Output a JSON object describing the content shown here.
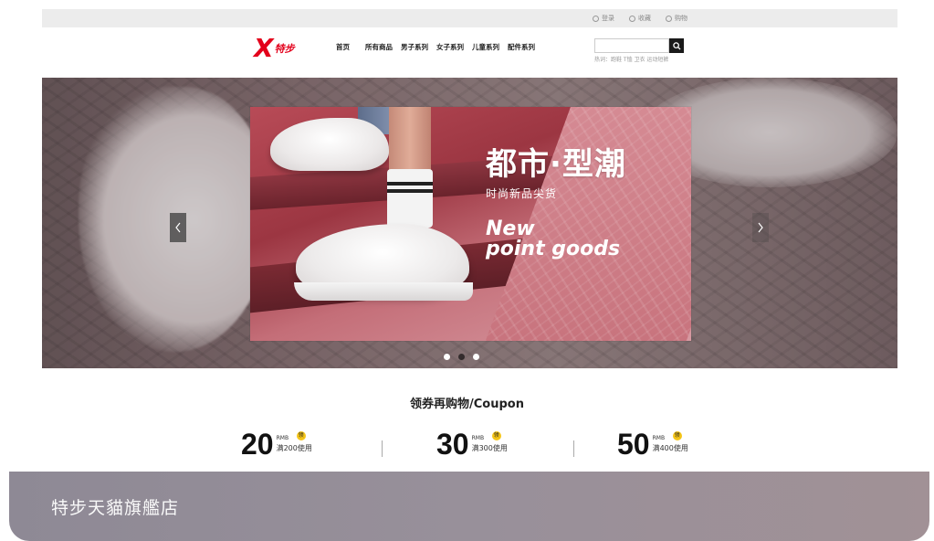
{
  "topbar": {
    "links": [
      {
        "label": "登录",
        "icon": "user-icon"
      },
      {
        "label": "收藏",
        "icon": "star-icon"
      },
      {
        "label": "购物",
        "icon": "cart-icon"
      }
    ]
  },
  "header": {
    "logo_text": "特步",
    "nav": [
      "首页",
      "所有商品",
      "男子系列",
      "女子系列",
      "儿童系列",
      "配件系列"
    ],
    "search": {
      "placeholder": "",
      "hot_words": "热词：跑鞋 T恤 卫衣 运动短裤"
    }
  },
  "banner": {
    "title": "都市·型潮",
    "subtitle": "时尚新品尖货",
    "en_line1": "New",
    "en_line2": "point goods",
    "slides_total": 3,
    "active_slide": 1
  },
  "coupons": {
    "title": "领券再购物/Coupon",
    "items": [
      {
        "amount": "20",
        "currency": "RMB",
        "badge": "领",
        "condition": "满200使用"
      },
      {
        "amount": "30",
        "currency": "RMB",
        "badge": "领",
        "condition": "满300使用"
      },
      {
        "amount": "50",
        "currency": "RMB",
        "badge": "领",
        "condition": "满400使用"
      }
    ]
  },
  "caption": {
    "text": "特步天貓旗艦店"
  },
  "colors": {
    "brand_red": "#e3001b",
    "coupon_badge": "#f5c518",
    "caption_bg": "#968f99"
  }
}
